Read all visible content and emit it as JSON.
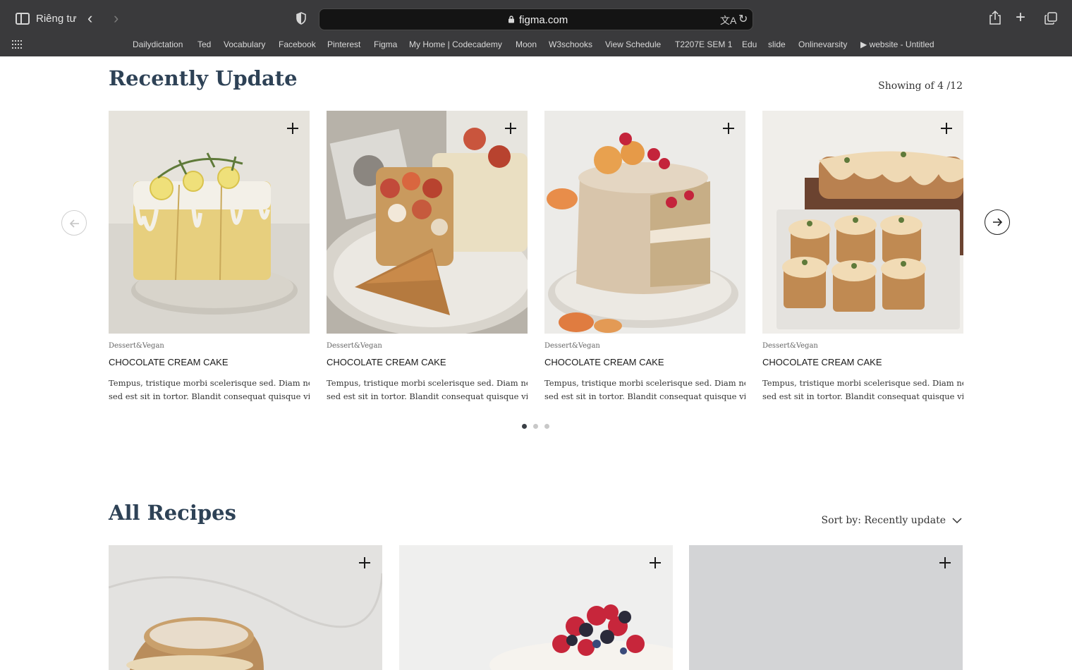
{
  "browser": {
    "private_label": "Riêng tư",
    "url": "figma.com",
    "bookmarks": [
      "Dailydictation",
      "Ted",
      "Vocabulary",
      "Facebook",
      "Pinterest",
      "Figma",
      "My Home | Codecademy",
      "Moon",
      "W3schooks",
      "View Schedule",
      "T2207E SEM 1",
      "Edu",
      "slide",
      "Onlinevarsity",
      "▶ website - Untitled"
    ]
  },
  "recent": {
    "title": "Recently Update",
    "showing": "Showing of 4 /12",
    "cards": [
      {
        "category": "Dessert&Vegan",
        "title": "CHOCOLATE CREAM CAKE",
        "desc_line1": "Tempus, tristique morbi scelerisque sed. Diam nec ut",
        "desc_line2": "sed est sit in tortor. Blandit consequat quisque vitae...",
        "image": "lemon-drizzle-cake"
      },
      {
        "category": "Dessert&Vegan",
        "title": "CHOCOLATE CREAM CAKE",
        "desc_line1": "Tempus, tristique morbi scelerisque sed. Diam nec ut",
        "desc_line2": "sed est sit in tortor. Blandit consequat quisque vitae...",
        "image": "fig-tart"
      },
      {
        "category": "Dessert&Vegan",
        "title": "CHOCOLATE CREAM CAKE",
        "desc_line1": "Tempus, tristique morbi scelerisque sed. Diam nec ut",
        "desc_line2": "sed est sit in tortor. Blandit consequat quisque vitae...",
        "image": "peach-layer-cake"
      },
      {
        "category": "Dessert&Vegan",
        "title": "CHOCOLATE CREAM CAKE",
        "desc_line1": "Tempus, tristique morbi scelerisque sed. Diam nec ut",
        "desc_line2": "sed est sit in tortor. Blandit consequat quisque vitae...",
        "image": "glazed-loaf-cakes"
      }
    ],
    "pagination": {
      "pages": 3,
      "active": 1
    }
  },
  "all_recipes": {
    "title": "All Recipes",
    "sort_label": "Sort by: Recently update",
    "items": [
      {
        "image": "cream-puff"
      },
      {
        "image": "berry-pavlova"
      },
      {
        "image": "grey-backdrop-dessert"
      }
    ]
  },
  "colors": {
    "heading": "#2e4256",
    "chrome_bg": "#3a3a3c",
    "dot_active": "#3a3f45",
    "dot_inactive": "#c8c8c8"
  },
  "icons": [
    "sidebar-icon",
    "back-icon",
    "forward-icon",
    "shield-icon",
    "lock-icon",
    "translate-icon",
    "reload-icon",
    "share-icon",
    "new-tab-icon",
    "tabs-overview-icon",
    "apps-grid-icon",
    "plus-icon",
    "arrow-left-icon",
    "arrow-right-icon",
    "chevron-down-icon"
  ]
}
